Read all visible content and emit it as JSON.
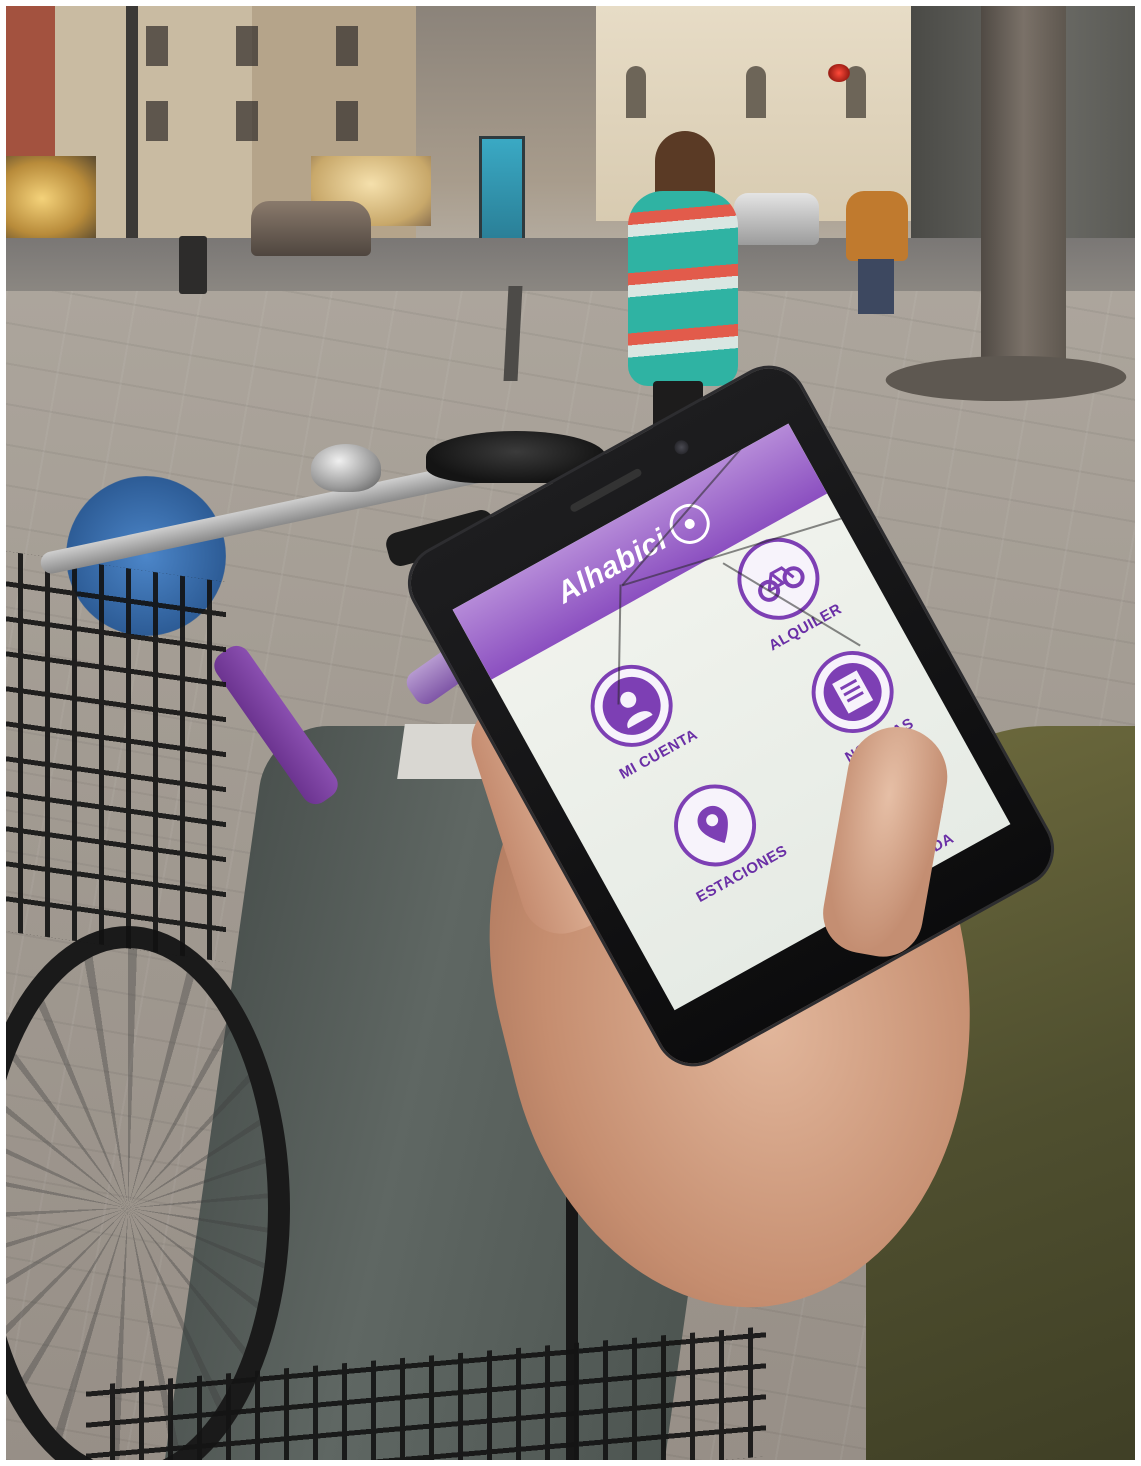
{
  "photo": {
    "subject": "hand-holding-phone-at-bike-station"
  },
  "app": {
    "brand": "Alhabici",
    "accent_color": "#7d3fb4",
    "header_color": "#9a62c9",
    "menu": [
      {
        "label": "ALQUILER",
        "icon": "bicycle-icon"
      },
      {
        "label": "MI CUENTA",
        "icon": "user-icon"
      },
      {
        "label": "NOTICIAS",
        "icon": "news-icon"
      },
      {
        "label": "ESTACIONES",
        "icon": "map-pin-icon"
      },
      {
        "label": "AYUDA",
        "icon": "chat-bubble-icon"
      }
    ]
  }
}
